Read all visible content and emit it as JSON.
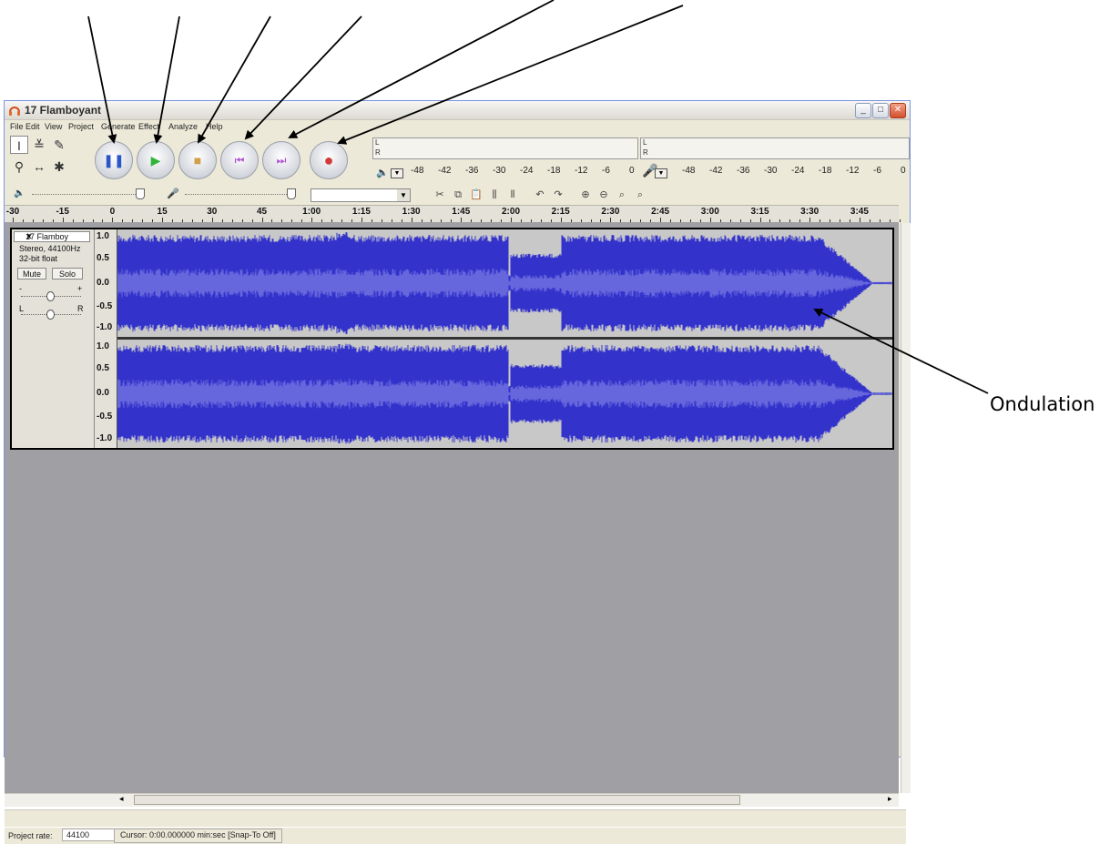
{
  "window": {
    "title": "17 Flamboyant",
    "min_label": "_",
    "max_label": "□",
    "close_label": "✕"
  },
  "menu": [
    "File",
    "Edit",
    "View",
    "Project",
    "Generate",
    "Effect",
    "Analyze",
    "Help"
  ],
  "tools": {
    "selection": "I",
    "envelope": "≚",
    "draw": "✎",
    "zoom": "⚲",
    "timeshift": "↔",
    "multi": "✱"
  },
  "transport": [
    {
      "name": "pause-button",
      "glyph": "❚❚",
      "color": "#2a56c7"
    },
    {
      "name": "play-button",
      "glyph": "▶",
      "color": "#31b53a"
    },
    {
      "name": "stop-button",
      "glyph": "■",
      "color": "#d2a04a"
    },
    {
      "name": "skip-start-button",
      "glyph": "⏮",
      "color": "#b04fd0"
    },
    {
      "name": "skip-end-button",
      "glyph": "⏭",
      "color": "#b04fd0"
    },
    {
      "name": "record-button",
      "glyph": "●",
      "color": "#d23b3b"
    }
  ],
  "meters": {
    "l": "L",
    "r": "R",
    "scale": [
      "-48",
      "-42",
      "-36",
      "-30",
      "-24",
      "-18",
      "-12",
      "-6",
      "0"
    ]
  },
  "timeline": {
    "labels": [
      "-30",
      "-15",
      "0",
      "15",
      "30",
      "45",
      "1:00",
      "1:15",
      "1:30",
      "1:45",
      "2:00",
      "2:15",
      "2:30",
      "2:45",
      "3:00",
      "3:15",
      "3:30",
      "3:45"
    ]
  },
  "track": {
    "name": "17 Flamboy",
    "close": "✕",
    "menu_arrow": "▼",
    "format": "Stereo, 44100Hz",
    "bitdepth": "32-bit float",
    "mute": "Mute",
    "solo": "Solo",
    "gain_minus": "-",
    "gain_plus": "+",
    "pan_l": "L",
    "pan_r": "R",
    "scale": [
      "1.0",
      "0.5",
      "0.0",
      "-0.5",
      "-1.0"
    ],
    "wave_color": "#3333cc",
    "wave_inner": "#6666dd"
  },
  "status": {
    "rate_label": "Project rate:",
    "rate_value": "44100",
    "cursor": "Cursor: 0:00.000000 min:sec  [Snap-To Off]"
  },
  "annotation": {
    "text": "Ondulation"
  }
}
